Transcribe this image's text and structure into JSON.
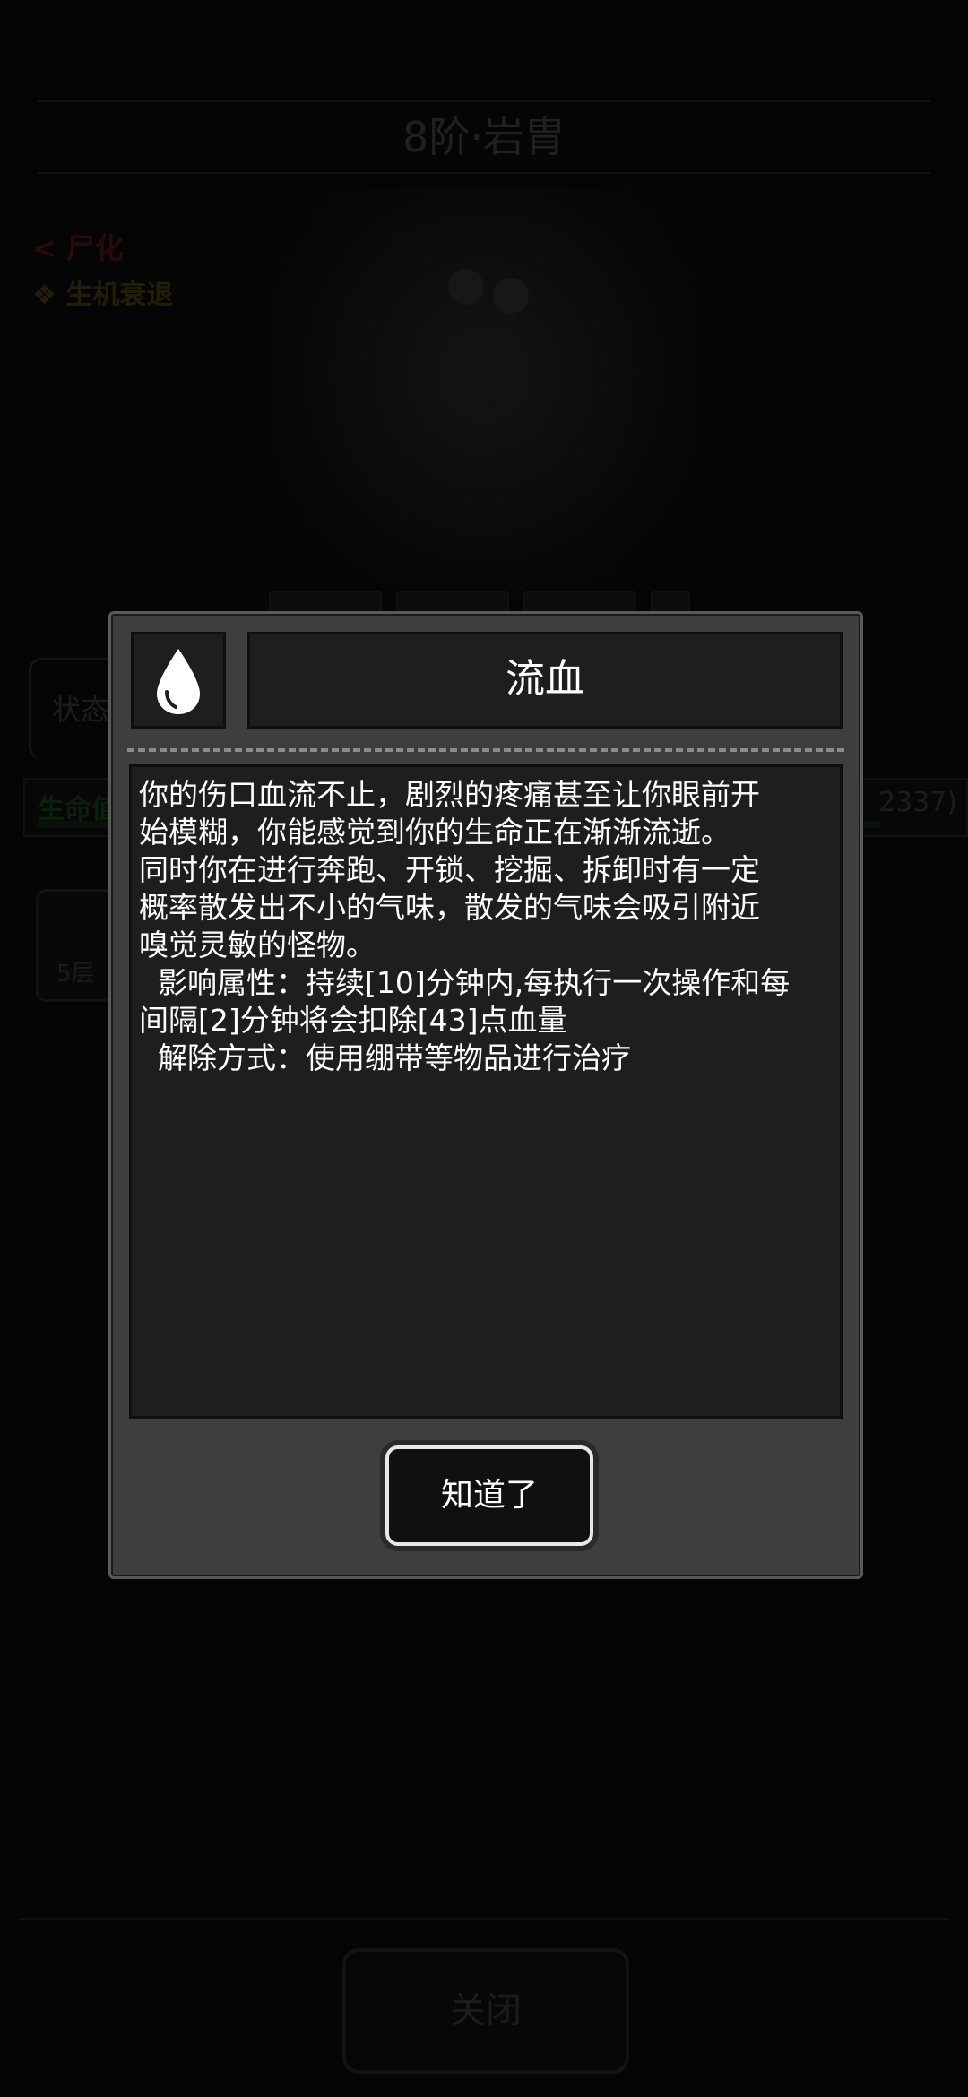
{
  "background": {
    "title": "8阶·岩胄",
    "back_label": "< 尸化",
    "tag_label": "❖ 生机衰退",
    "status_tab": "状态",
    "life_label": "生命值",
    "life_count": "2337)",
    "effect_stack": "5层"
  },
  "dialog": {
    "icon": "blood-drop-icon",
    "title": "流血",
    "description_lines": [
      "你的伤口血流不止，剧烈的疼痛甚至让你眼前开",
      "始模糊，你能感觉到你的生命正在渐渐流逝。",
      "同时你在进行奔跑、开锁、挖掘、拆卸时有一定",
      "概率散发出不小的气味，散发的气味会吸引附近",
      "嗅觉灵敏的怪物。",
      "  影响属性：持续[10]分钟内,每执行一次操作和每",
      "间隔[2]分钟将会扣除[43]点血量",
      "  解除方式：使用绷带等物品进行治疗"
    ],
    "confirm_label": "知道了"
  },
  "footer": {
    "close_label": "关闭"
  },
  "colors": {
    "dialog_bg": "#3e3e3e",
    "panel_bg": "#1e1e1e",
    "text": "#ffffff"
  }
}
